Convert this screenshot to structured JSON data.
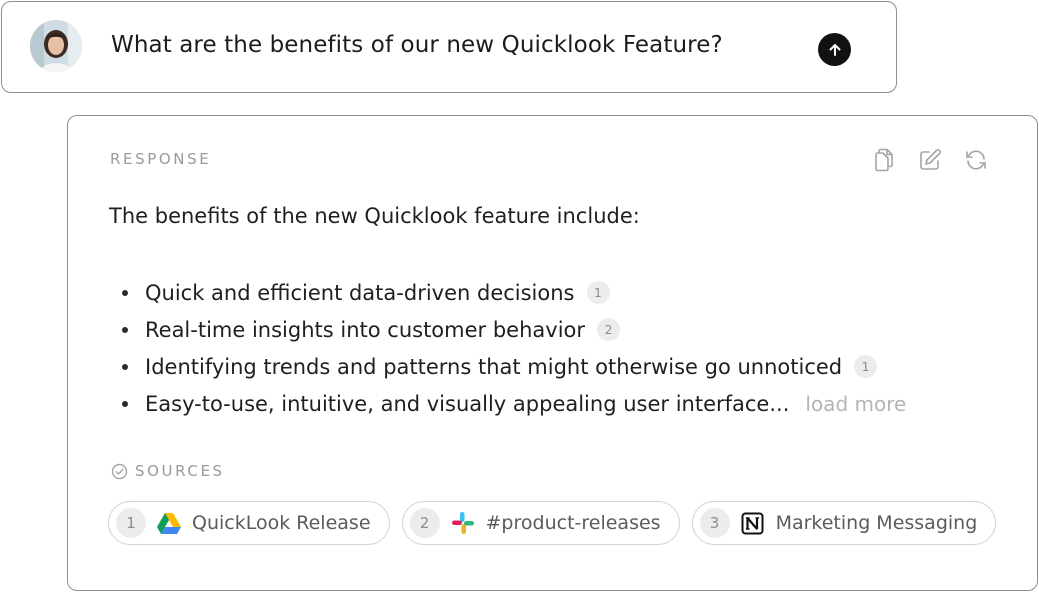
{
  "query": {
    "text": "What are the benefits of our new Quicklook Feature?",
    "send_icon": "arrow-up-icon"
  },
  "response": {
    "label": "RESPONSE",
    "actions": [
      "copy-icon",
      "edit-icon",
      "refresh-icon"
    ],
    "intro": "The benefits of the new Quicklook feature include:",
    "bullets": [
      {
        "text": "Quick and efficient data-driven decisions",
        "cite": "1"
      },
      {
        "text": "Real-time insights into customer behavior",
        "cite": "2"
      },
      {
        "text": "Identifying trends and patterns that might otherwise go unnoticed",
        "cite": "1"
      },
      {
        "text": "Easy-to-use, intuitive, and visually appealing user interface...",
        "cite": ""
      }
    ],
    "load_more": "load more"
  },
  "sources": {
    "label": "SOURCES",
    "items": [
      {
        "num": "1",
        "icon": "google-drive-icon",
        "label": "QuickLook Release"
      },
      {
        "num": "2",
        "icon": "slack-icon",
        "label": "#product-releases"
      },
      {
        "num": "3",
        "icon": "notion-icon",
        "label": "Marketing Messaging"
      }
    ]
  },
  "colors": {
    "border": "#8f8f8f",
    "muted": "#9a9a9a",
    "chip_bg": "#ececec",
    "send_button": "#111111"
  }
}
